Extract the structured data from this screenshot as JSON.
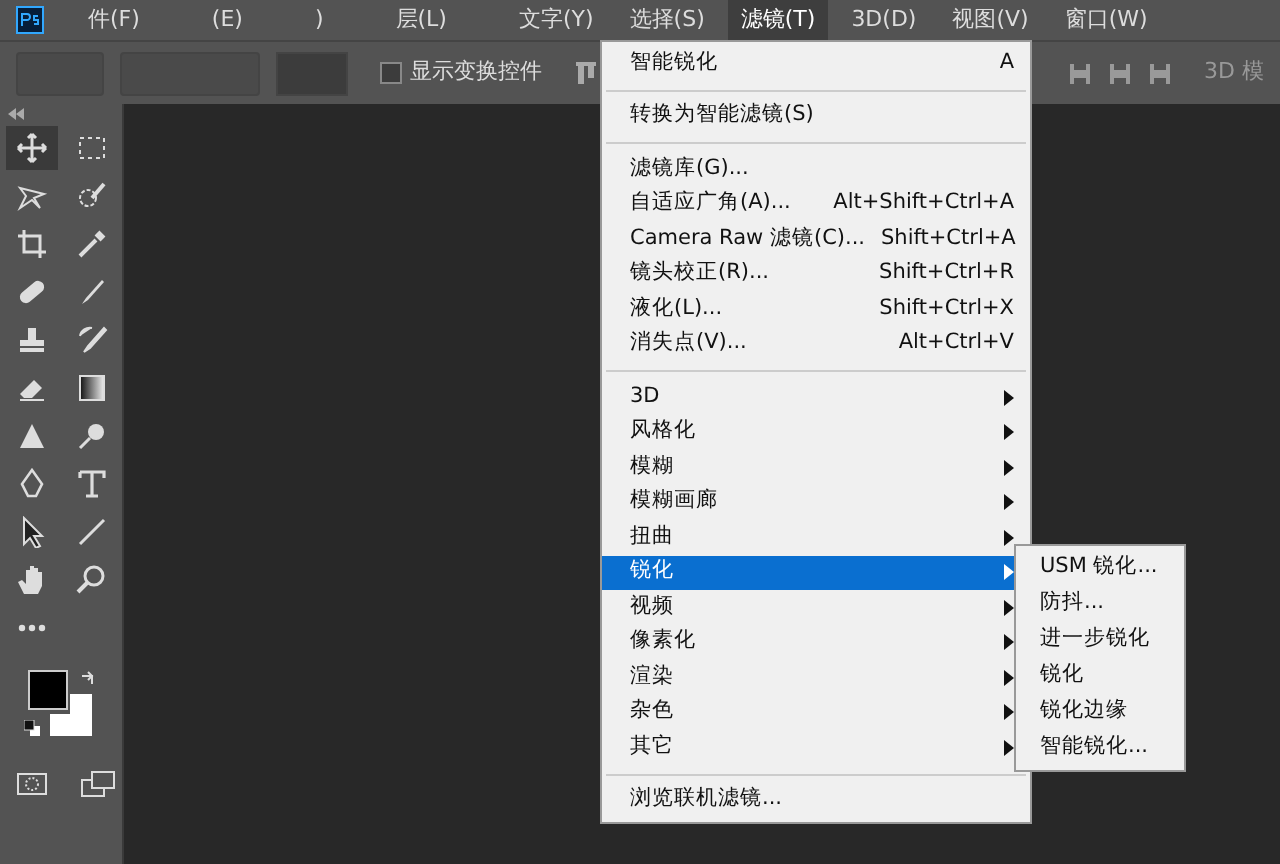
{
  "menu_bar": [
    {
      "label": "件(F)",
      "selected": false
    },
    {
      "label": "(E)",
      "selected": false
    },
    {
      "label": ")",
      "selected": false
    },
    {
      "label": "层(L)",
      "selected": false
    },
    {
      "label": "文字(Y)",
      "selected": false
    },
    {
      "label": "选择(S)",
      "selected": false
    },
    {
      "label": "滤镜(T)",
      "selected": true
    },
    {
      "label": "3D(D)",
      "selected": false
    },
    {
      "label": "视图(V)",
      "selected": false
    },
    {
      "label": "窗口(W)",
      "selected": false
    }
  ],
  "options_bar": {
    "checkbox": {
      "label": "显示变换控件",
      "checked": false
    },
    "label_3d": "3D 模"
  },
  "tools": [
    {
      "kind": "move",
      "selected": true
    },
    {
      "kind": "marquee",
      "selected": false
    },
    {
      "kind": "lasso",
      "selected": false
    },
    {
      "kind": "quick-select",
      "selected": false
    },
    {
      "kind": "crop",
      "selected": false
    },
    {
      "kind": "eyedropper",
      "selected": false
    },
    {
      "kind": "bandage",
      "selected": false
    },
    {
      "kind": "brush",
      "selected": false
    },
    {
      "kind": "stamp",
      "selected": false
    },
    {
      "kind": "history-brush",
      "selected": false
    },
    {
      "kind": "eraser",
      "selected": false
    },
    {
      "kind": "gradient",
      "selected": false
    },
    {
      "kind": "triangle",
      "selected": false
    },
    {
      "kind": "dodge",
      "selected": false
    },
    {
      "kind": "pen",
      "selected": false
    },
    {
      "kind": "type",
      "selected": false
    },
    {
      "kind": "pointer",
      "selected": false
    },
    {
      "kind": "line",
      "selected": false
    },
    {
      "kind": "hand",
      "selected": false
    },
    {
      "kind": "zoom",
      "selected": false
    },
    {
      "kind": "more",
      "selected": false
    }
  ],
  "filter_menu": [
    {
      "kind": "item",
      "label": "智能锐化",
      "shortcut": "A",
      "submenu": false,
      "selected": false
    },
    {
      "kind": "separator"
    },
    {
      "kind": "item",
      "label": "转换为智能滤镜(S)",
      "submenu": false,
      "selected": false
    },
    {
      "kind": "separator"
    },
    {
      "kind": "item",
      "label": "滤镜库(G)...",
      "submenu": false,
      "selected": false
    },
    {
      "kind": "item",
      "label": "自适应广角(A)...",
      "shortcut": "Alt+Shift+Ctrl+A",
      "submenu": false,
      "selected": false
    },
    {
      "kind": "item",
      "label": "Camera Raw 滤镜(C)...",
      "shortcut": "Shift+Ctrl+A",
      "submenu": false,
      "selected": false
    },
    {
      "kind": "item",
      "label": "镜头校正(R)...",
      "shortcut": "Shift+Ctrl+R",
      "submenu": false,
      "selected": false
    },
    {
      "kind": "item",
      "label": "液化(L)...",
      "shortcut": "Shift+Ctrl+X",
      "submenu": false,
      "selected": false
    },
    {
      "kind": "item",
      "label": "消失点(V)...",
      "shortcut": "Alt+Ctrl+V",
      "submenu": false,
      "selected": false
    },
    {
      "kind": "separator"
    },
    {
      "kind": "item",
      "label": "3D",
      "submenu": true,
      "selected": false
    },
    {
      "kind": "item",
      "label": "风格化",
      "submenu": true,
      "selected": false
    },
    {
      "kind": "item",
      "label": "模糊",
      "submenu": true,
      "selected": false
    },
    {
      "kind": "item",
      "label": "模糊画廊",
      "submenu": true,
      "selected": false
    },
    {
      "kind": "item",
      "label": "扭曲",
      "submenu": true,
      "selected": false
    },
    {
      "kind": "item",
      "label": "锐化",
      "submenu": true,
      "selected": true
    },
    {
      "kind": "item",
      "label": "视频",
      "submenu": true,
      "selected": false
    },
    {
      "kind": "item",
      "label": "像素化",
      "submenu": true,
      "selected": false
    },
    {
      "kind": "item",
      "label": "渲染",
      "submenu": true,
      "selected": false
    },
    {
      "kind": "item",
      "label": "杂色",
      "submenu": true,
      "selected": false
    },
    {
      "kind": "item",
      "label": "其它",
      "submenu": true,
      "selected": false
    },
    {
      "kind": "separator"
    },
    {
      "kind": "item",
      "label": "浏览联机滤镜...",
      "submenu": false,
      "selected": false
    }
  ],
  "sharpen_submenu": [
    {
      "label": "USM 锐化..."
    },
    {
      "label": "防抖..."
    },
    {
      "label": "进一步锐化"
    },
    {
      "label": "锐化"
    },
    {
      "label": "锐化边缘"
    },
    {
      "label": "智能锐化..."
    }
  ]
}
